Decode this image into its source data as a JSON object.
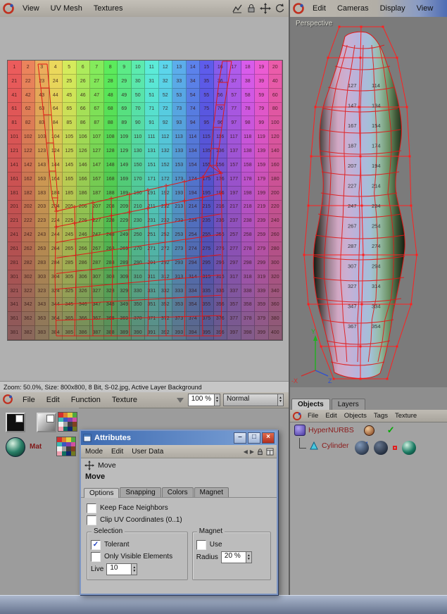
{
  "top_left_menu": {
    "items": [
      "View",
      "UV Mesh",
      "Textures"
    ]
  },
  "top_right_menu": {
    "items": [
      "Edit",
      "Cameras",
      "Display",
      "View"
    ]
  },
  "uv_view": {
    "grid": {
      "rows": 20,
      "cols": 20,
      "first_number": 1,
      "last_number": 400
    },
    "status_text": "Zoom: 50.0%, Size: 800x800, 8 Bit, S-02.jpg, Active Layer Background"
  },
  "perspective_view": {
    "label": "Perspective",
    "axis": {
      "y": "Y",
      "x": "-X",
      "z": "Z"
    },
    "texture_numbers_col1": [
      "127",
      "147",
      "167",
      "187",
      "207",
      "227",
      "247",
      "267",
      "287",
      "307",
      "327",
      "347",
      "367"
    ],
    "texture_numbers_col2": [
      "114",
      "134",
      "154",
      "174",
      "194",
      "214",
      "234",
      "254",
      "274",
      "294",
      "314",
      "334",
      "354"
    ]
  },
  "texture_menu": {
    "items": [
      "File",
      "Edit",
      "Function",
      "Texture"
    ],
    "zoom_value": "100 %",
    "blend_mode": "Normal"
  },
  "object_manager": {
    "tabs": [
      {
        "label": "Objects"
      },
      {
        "label": "Layers"
      }
    ],
    "menu_items": [
      "File",
      "Edit",
      "Objects",
      "Tags",
      "Texture"
    ],
    "tree": [
      {
        "label": "HyperNURBS"
      },
      {
        "label": "Cylinder"
      }
    ]
  },
  "materials_panel": {
    "label": "Mat"
  },
  "attributes": {
    "title": "Attributes",
    "menu_items": [
      "Mode",
      "Edit",
      "User Data"
    ],
    "tool_name": "Move",
    "section_title": "Move",
    "tabs": [
      "Options",
      "Snapping",
      "Colors",
      "Magnet"
    ],
    "active_tab": "Options",
    "keep_face_neighbors": {
      "label": "Keep Face Neighbors",
      "checked": false
    },
    "clip_uv": {
      "label": "Clip UV Coordinates (0..1)",
      "checked": false
    },
    "selection": {
      "title": "Selection",
      "tolerant": {
        "label": "Tolerant",
        "checked": true
      },
      "only_visible": {
        "label": "Only Visible Elements",
        "checked": false
      },
      "live": {
        "label": "Live",
        "value": "10"
      }
    },
    "magnet": {
      "title": "Magnet",
      "use": {
        "label": "Use",
        "checked": false
      },
      "radius": {
        "label": "Radius",
        "value": "20 %"
      }
    }
  },
  "glyphs": {
    "check": "✓",
    "spin_up": "▲",
    "spin_down": "▼",
    "nav_back": "◀",
    "nav_forward": "▶"
  }
}
